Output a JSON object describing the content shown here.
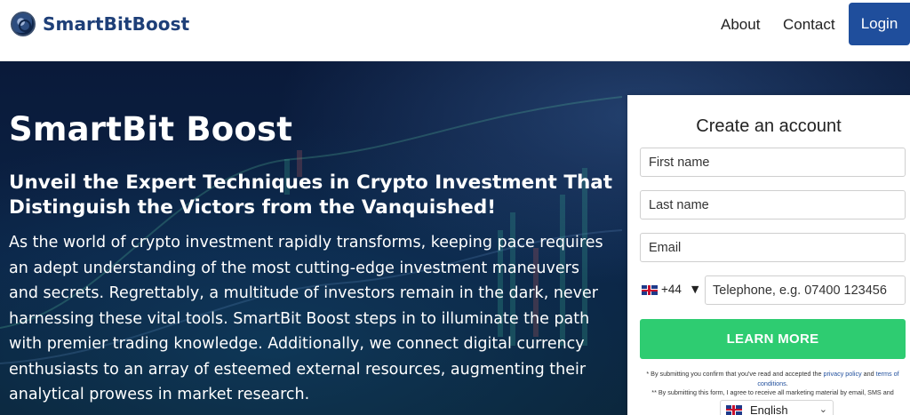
{
  "header": {
    "brand_name": "SmartBitBoost",
    "nav": {
      "about": "About",
      "contact": "Contact",
      "login": "Login"
    }
  },
  "hero": {
    "title": "SmartBit Boost",
    "subtitle": "Unveil the Expert Techniques in Crypto Investment That Distinguish the Victors from the Vanquished!",
    "paragraph": "As the world of crypto investment rapidly transforms, keeping pace requires an adept understanding of the most cutting-edge investment maneuvers and secrets. Regrettably, a multitude of investors remain in the dark, never harnessing these vital tools. SmartBit Boost steps in to illuminate the path with premier trading knowledge. Additionally, we connect digital currency enthusiasts to an array of esteemed external resources, augmenting their analytical prowess in market research."
  },
  "form": {
    "title": "Create an account",
    "first_name_placeholder": "First name",
    "last_name_placeholder": "Last name",
    "email_placeholder": "Email",
    "phone_code": "+44",
    "phone_placeholder": "Telephone, e.g.  07400 123456",
    "submit_label": "LEARN MORE",
    "note1_prefix": "* By submitting you confirm that you've read and accepted the ",
    "note1_privacy": "privacy policy",
    "note1_and": " and ",
    "note1_terms": "terms of conditions",
    "note1_suffix": ".",
    "note2": "** By submitting this form, I agree to receive all marketing material by email, SMS and",
    "language": "English"
  },
  "colors": {
    "brand": "#1e3f78",
    "login_button": "#1f4e9c",
    "submit_button": "#2ecc71",
    "hero_background": "#0b2244"
  },
  "icons": {
    "logo": "circular-eye-logo",
    "country_flag": "uk-flag-icon",
    "dropdown": "caret-down-icon"
  }
}
